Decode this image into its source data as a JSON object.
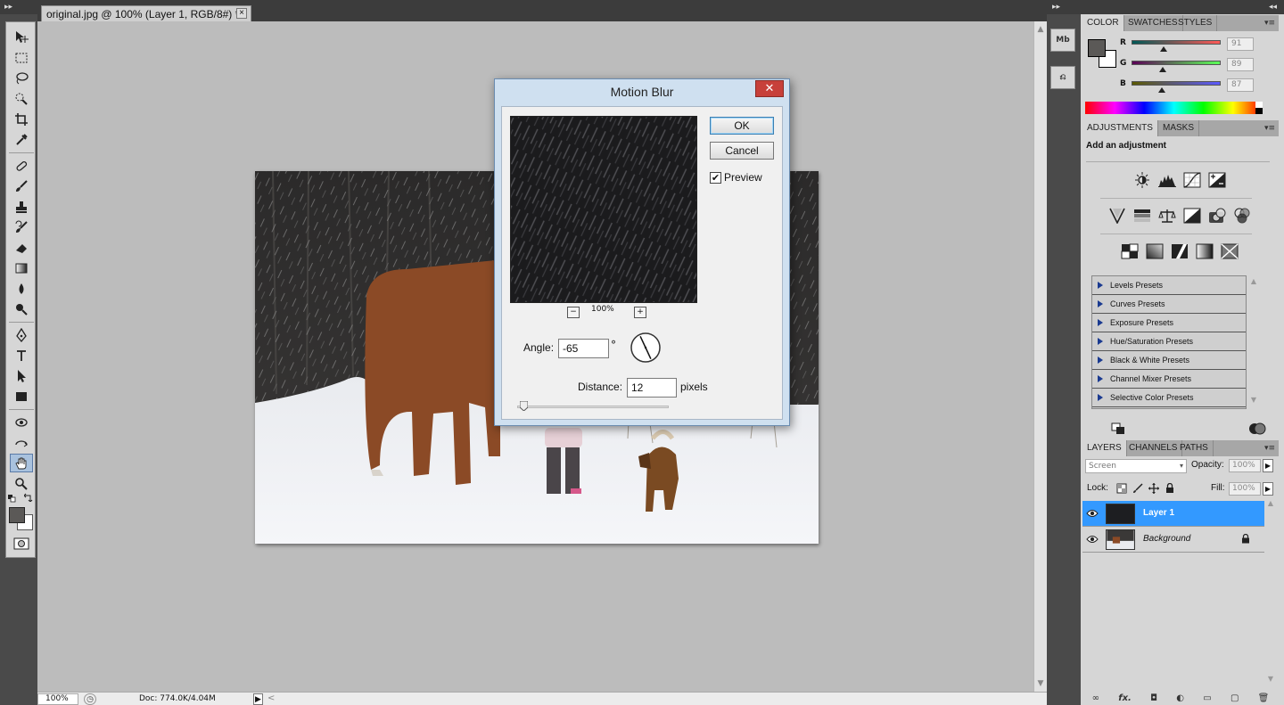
{
  "document": {
    "tab_title": "original.jpg @ 100% (Layer 1, RGB/8#) *",
    "tab_close": "×"
  },
  "status": {
    "zoom": "100%",
    "doc_size": "Doc: 774.0K/4.04M",
    "arrow": "▶",
    "scroll_left": "<"
  },
  "scrollbar": {
    "up": "▲",
    "down": "▼"
  },
  "dialog": {
    "title": "Motion Blur",
    "close": "✕",
    "ok": "OK",
    "cancel": "Cancel",
    "preview_label": "Preview",
    "preview_checked": "✔",
    "zoom_out": "−",
    "zoom_in": "+",
    "preview_zoom": "100%",
    "angle_label": "Angle:",
    "angle_value": "-65",
    "degree": "°",
    "distance_label": "Distance:",
    "distance_value": "12",
    "distance_unit": "pixels"
  },
  "color_panel": {
    "tabs": [
      "COLOR",
      "SWATCHES",
      "STYLES"
    ],
    "channels": [
      {
        "label": "R",
        "value": "91",
        "fraction": 0.357
      },
      {
        "label": "G",
        "value": "89",
        "fraction": 0.349
      },
      {
        "label": "B",
        "value": "87",
        "fraction": 0.341
      }
    ],
    "foreground_color": "#5b5957",
    "background_color": "#ffffff"
  },
  "adjustments_panel": {
    "tabs": [
      "ADJUSTMENTS",
      "MASKS"
    ],
    "title": "Add an adjustment",
    "presets": [
      "Levels Presets",
      "Curves Presets",
      "Exposure Presets",
      "Hue/Saturation Presets",
      "Black & White Presets",
      "Channel Mixer Presets",
      "Selective Color Presets"
    ]
  },
  "layers_panel": {
    "tabs": [
      "LAYERS",
      "CHANNELS",
      "PATHS"
    ],
    "blend_mode": "Screen",
    "blend_caret": "▾",
    "opacity_label": "Opacity:",
    "opacity_value": "100%",
    "lock_label": "Lock:",
    "fill_label": "Fill:",
    "fill_value": "100%",
    "arrow": "▶",
    "layers": [
      {
        "name": "Layer 1",
        "selected": true
      },
      {
        "name": "Background",
        "selected": false
      }
    ],
    "footer_icons": [
      "link-icon",
      "fx-icon",
      "mask-icon",
      "adjustment-layer-icon",
      "group-icon",
      "new-layer-icon",
      "trash-icon"
    ],
    "footer": {
      "link": "∞",
      "fx": "fx.",
      "mask": "◘",
      "adjust": "◐",
      "group": "▭",
      "new": "▢",
      "trash": "🗑"
    }
  },
  "panel_menu": "▾≡",
  "collapse": "◂◂",
  "expand": "▸▸",
  "dock": {
    "mini_bridge": "Mb",
    "history": "⎌"
  }
}
